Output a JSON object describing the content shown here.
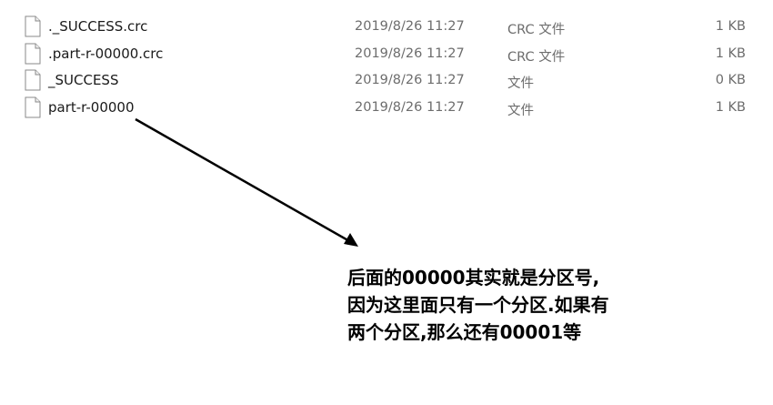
{
  "files": [
    {
      "name": "._SUCCESS.crc",
      "date": "2019/8/26 11:27",
      "type": "CRC 文件",
      "size": "1 KB",
      "icon": "file-icon"
    },
    {
      "name": ".part-r-00000.crc",
      "date": "2019/8/26 11:27",
      "type": "CRC 文件",
      "size": "1 KB",
      "icon": "file-icon"
    },
    {
      "name": "_SUCCESS",
      "date": "2019/8/26 11:27",
      "type": "文件",
      "size": "0 KB",
      "icon": "file-icon"
    },
    {
      "name": "part-r-00000",
      "date": "2019/8/26 11:27",
      "type": "文件",
      "size": "1 KB",
      "icon": "file-icon"
    }
  ],
  "annotation": {
    "lines": [
      "后面的00000其实就是分区号,",
      "因为这里面只有一个分区.如果有",
      "两个分区,那么还有00001等"
    ],
    "color": "#000000"
  },
  "colors": {
    "name_text": "#1a1a1a",
    "meta_text": "#6d6d6d",
    "arrow": "#000000"
  }
}
